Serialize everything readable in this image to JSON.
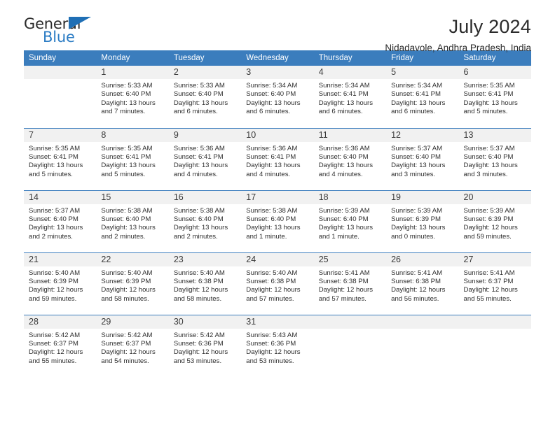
{
  "brand": {
    "name_dark": "General",
    "name_blue": "Blue",
    "color_blue": "#2b7cc4",
    "triangle_color": "#1f6fb5"
  },
  "header": {
    "title": "July 2024",
    "subtitle": "Nidadavole, Andhra Pradesh, India"
  },
  "theme": {
    "header_row_bg": "#3b7dbd",
    "daynum_bg": "#f1f1f1",
    "text": "#2e2e2e"
  },
  "weekdays": [
    "Sunday",
    "Monday",
    "Tuesday",
    "Wednesday",
    "Thursday",
    "Friday",
    "Saturday"
  ],
  "weeks": [
    [
      {
        "day": "",
        "sunrise": "",
        "sunset": "",
        "daylight": ""
      },
      {
        "day": "1",
        "sunrise": "Sunrise: 5:33 AM",
        "sunset": "Sunset: 6:40 PM",
        "daylight": "Daylight: 13 hours and 7 minutes."
      },
      {
        "day": "2",
        "sunrise": "Sunrise: 5:33 AM",
        "sunset": "Sunset: 6:40 PM",
        "daylight": "Daylight: 13 hours and 6 minutes."
      },
      {
        "day": "3",
        "sunrise": "Sunrise: 5:34 AM",
        "sunset": "Sunset: 6:40 PM",
        "daylight": "Daylight: 13 hours and 6 minutes."
      },
      {
        "day": "4",
        "sunrise": "Sunrise: 5:34 AM",
        "sunset": "Sunset: 6:41 PM",
        "daylight": "Daylight: 13 hours and 6 minutes."
      },
      {
        "day": "5",
        "sunrise": "Sunrise: 5:34 AM",
        "sunset": "Sunset: 6:41 PM",
        "daylight": "Daylight: 13 hours and 6 minutes."
      },
      {
        "day": "6",
        "sunrise": "Sunrise: 5:35 AM",
        "sunset": "Sunset: 6:41 PM",
        "daylight": "Daylight: 13 hours and 5 minutes."
      }
    ],
    [
      {
        "day": "7",
        "sunrise": "Sunrise: 5:35 AM",
        "sunset": "Sunset: 6:41 PM",
        "daylight": "Daylight: 13 hours and 5 minutes."
      },
      {
        "day": "8",
        "sunrise": "Sunrise: 5:35 AM",
        "sunset": "Sunset: 6:41 PM",
        "daylight": "Daylight: 13 hours and 5 minutes."
      },
      {
        "day": "9",
        "sunrise": "Sunrise: 5:36 AM",
        "sunset": "Sunset: 6:41 PM",
        "daylight": "Daylight: 13 hours and 4 minutes."
      },
      {
        "day": "10",
        "sunrise": "Sunrise: 5:36 AM",
        "sunset": "Sunset: 6:41 PM",
        "daylight": "Daylight: 13 hours and 4 minutes."
      },
      {
        "day": "11",
        "sunrise": "Sunrise: 5:36 AM",
        "sunset": "Sunset: 6:40 PM",
        "daylight": "Daylight: 13 hours and 4 minutes."
      },
      {
        "day": "12",
        "sunrise": "Sunrise: 5:37 AM",
        "sunset": "Sunset: 6:40 PM",
        "daylight": "Daylight: 13 hours and 3 minutes."
      },
      {
        "day": "13",
        "sunrise": "Sunrise: 5:37 AM",
        "sunset": "Sunset: 6:40 PM",
        "daylight": "Daylight: 13 hours and 3 minutes."
      }
    ],
    [
      {
        "day": "14",
        "sunrise": "Sunrise: 5:37 AM",
        "sunset": "Sunset: 6:40 PM",
        "daylight": "Daylight: 13 hours and 2 minutes."
      },
      {
        "day": "15",
        "sunrise": "Sunrise: 5:38 AM",
        "sunset": "Sunset: 6:40 PM",
        "daylight": "Daylight: 13 hours and 2 minutes."
      },
      {
        "day": "16",
        "sunrise": "Sunrise: 5:38 AM",
        "sunset": "Sunset: 6:40 PM",
        "daylight": "Daylight: 13 hours and 2 minutes."
      },
      {
        "day": "17",
        "sunrise": "Sunrise: 5:38 AM",
        "sunset": "Sunset: 6:40 PM",
        "daylight": "Daylight: 13 hours and 1 minute."
      },
      {
        "day": "18",
        "sunrise": "Sunrise: 5:39 AM",
        "sunset": "Sunset: 6:40 PM",
        "daylight": "Daylight: 13 hours and 1 minute."
      },
      {
        "day": "19",
        "sunrise": "Sunrise: 5:39 AM",
        "sunset": "Sunset: 6:39 PM",
        "daylight": "Daylight: 13 hours and 0 minutes."
      },
      {
        "day": "20",
        "sunrise": "Sunrise: 5:39 AM",
        "sunset": "Sunset: 6:39 PM",
        "daylight": "Daylight: 12 hours and 59 minutes."
      }
    ],
    [
      {
        "day": "21",
        "sunrise": "Sunrise: 5:40 AM",
        "sunset": "Sunset: 6:39 PM",
        "daylight": "Daylight: 12 hours and 59 minutes."
      },
      {
        "day": "22",
        "sunrise": "Sunrise: 5:40 AM",
        "sunset": "Sunset: 6:39 PM",
        "daylight": "Daylight: 12 hours and 58 minutes."
      },
      {
        "day": "23",
        "sunrise": "Sunrise: 5:40 AM",
        "sunset": "Sunset: 6:38 PM",
        "daylight": "Daylight: 12 hours and 58 minutes."
      },
      {
        "day": "24",
        "sunrise": "Sunrise: 5:40 AM",
        "sunset": "Sunset: 6:38 PM",
        "daylight": "Daylight: 12 hours and 57 minutes."
      },
      {
        "day": "25",
        "sunrise": "Sunrise: 5:41 AM",
        "sunset": "Sunset: 6:38 PM",
        "daylight": "Daylight: 12 hours and 57 minutes."
      },
      {
        "day": "26",
        "sunrise": "Sunrise: 5:41 AM",
        "sunset": "Sunset: 6:38 PM",
        "daylight": "Daylight: 12 hours and 56 minutes."
      },
      {
        "day": "27",
        "sunrise": "Sunrise: 5:41 AM",
        "sunset": "Sunset: 6:37 PM",
        "daylight": "Daylight: 12 hours and 55 minutes."
      }
    ],
    [
      {
        "day": "28",
        "sunrise": "Sunrise: 5:42 AM",
        "sunset": "Sunset: 6:37 PM",
        "daylight": "Daylight: 12 hours and 55 minutes."
      },
      {
        "day": "29",
        "sunrise": "Sunrise: 5:42 AM",
        "sunset": "Sunset: 6:37 PM",
        "daylight": "Daylight: 12 hours and 54 minutes."
      },
      {
        "day": "30",
        "sunrise": "Sunrise: 5:42 AM",
        "sunset": "Sunset: 6:36 PM",
        "daylight": "Daylight: 12 hours and 53 minutes."
      },
      {
        "day": "31",
        "sunrise": "Sunrise: 5:43 AM",
        "sunset": "Sunset: 6:36 PM",
        "daylight": "Daylight: 12 hours and 53 minutes."
      },
      {
        "day": "",
        "sunrise": "",
        "sunset": "",
        "daylight": ""
      },
      {
        "day": "",
        "sunrise": "",
        "sunset": "",
        "daylight": ""
      },
      {
        "day": "",
        "sunrise": "",
        "sunset": "",
        "daylight": ""
      }
    ]
  ]
}
